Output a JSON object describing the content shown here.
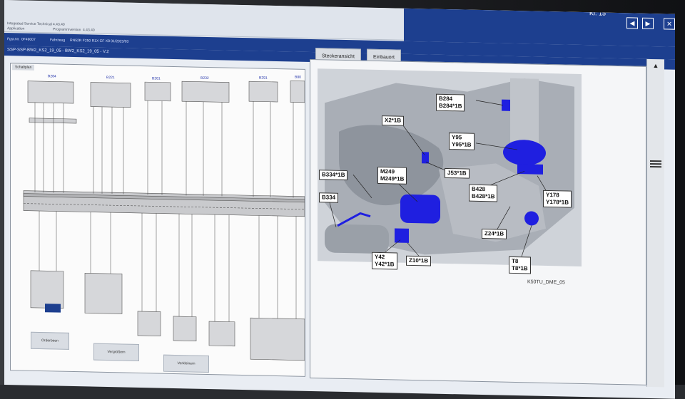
{
  "window": {
    "app_name": "Integrated Service Technical",
    "app_version": "4.43.40",
    "program_version_label": "Programmversion",
    "program_version": "4.43.40",
    "application_label": "Application",
    "kl_status": "Kl. 15",
    "vehicle_info_label": "Fahrzeug",
    "vehicle_info": "RN52R F250 R1X CF X8 01/2023/03",
    "fgstnr_label": "Fgst.Nr.",
    "fgstnr": "0F49007"
  },
  "breadcrumb": "SSP-SSP-BW2_KS2_19_05 - BW2_KS2_19_05 - V.2",
  "tabs": {
    "connector_view": "Steckeransicht",
    "installation_location": "Einbauort"
  },
  "left_pane": {
    "tab_label": "Schaltplan",
    "bottom_buttons": [
      "Orderbeen",
      "Vergrößern",
      "Verkleinern"
    ],
    "component_labels": [
      "B284",
      "B221",
      "B261",
      "B232",
      "B291",
      "B80"
    ]
  },
  "right_pane": {
    "figure_id": "K50TU_DME_05",
    "callouts": [
      {
        "text": "B284\nB284*1B"
      },
      {
        "text": "X2*1B"
      },
      {
        "text": "Y95\nY95*1B"
      },
      {
        "text": "J53*1B"
      },
      {
        "text": "B334*1B"
      },
      {
        "text": "M249\nM249*1B"
      },
      {
        "text": "B428\nB428*1B"
      },
      {
        "text": "Y178\nY178*1B"
      },
      {
        "text": "B334"
      },
      {
        "text": "Z24*1B"
      },
      {
        "text": "Y42\nY42*1B"
      },
      {
        "text": "Z10*1B"
      },
      {
        "text": "T8\nT8*1B"
      }
    ]
  },
  "colors": {
    "accent": "#1d3f8f",
    "highlight": "#1f1fe0",
    "panel": "#f5f6f8"
  }
}
